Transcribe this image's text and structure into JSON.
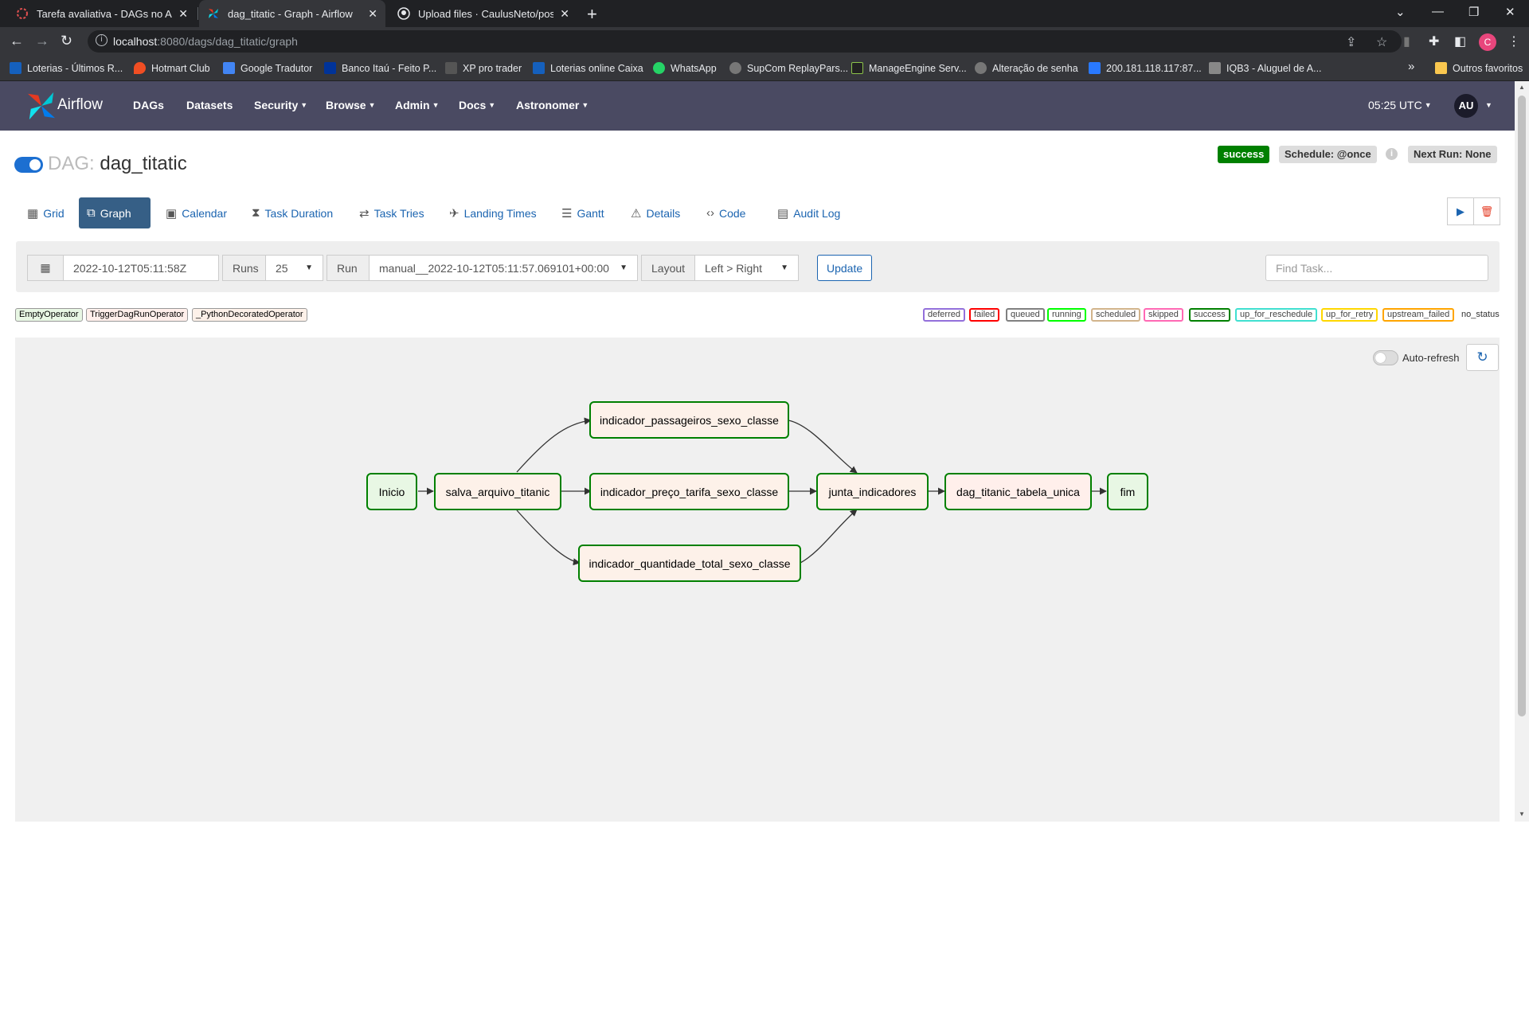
{
  "browser": {
    "tabs": [
      {
        "title": "Tarefa avaliativa - DAGs no Airflo"
      },
      {
        "title": "dag_titatic - Graph - Airflow"
      },
      {
        "title": "Upload files · CaulusNeto/pos-Pr"
      }
    ],
    "url_host": "localhost",
    "url_path": ":8080/dags/dag_titatic/graph",
    "bookmarks": [
      "Loterias - Últimos R...",
      "Hotmart Club",
      "Google Tradutor",
      "Banco Itaú - Feito P...",
      "XP pro trader",
      "Loterias online Caixa",
      "WhatsApp",
      "SupCom ReplayPars...",
      "ManageEngine Serv...",
      "Alteração de senha",
      "200.181.118.117:87...",
      "IQB3 - Aluguel de A..."
    ],
    "bookmarks_more": "»",
    "other_bookmarks": "Outros favoritos",
    "profile_initial": "C"
  },
  "navbar": {
    "brand": "Airflow",
    "links": [
      "DAGs",
      "Datasets",
      "Security",
      "Browse",
      "Admin",
      "Docs",
      "Astronomer"
    ],
    "time": "05:25 UTC",
    "user": "AU"
  },
  "dag": {
    "prefix": "DAG:",
    "name": "dag_titatic",
    "status": "success",
    "schedule": "Schedule: @once",
    "next_run": "Next Run: None"
  },
  "views": [
    "Grid",
    "Graph",
    "Calendar",
    "Task Duration",
    "Task Tries",
    "Landing Times",
    "Gantt",
    "Details",
    "Code",
    "Audit Log"
  ],
  "active_view": "Graph",
  "controls": {
    "date": "2022-10-12T05:11:58Z",
    "runs_label": "Runs",
    "runs_value": "25",
    "run_label": "Run",
    "run_value": "manual__2022-10-12T05:11:57.069101+00:00",
    "layout_label": "Layout",
    "layout_value": "Left > Right",
    "update": "Update",
    "find_placeholder": "Find Task..."
  },
  "operators": [
    "EmptyOperator",
    "TriggerDagRunOperator",
    "_PythonDecoratedOperator"
  ],
  "statuses": [
    {
      "name": "deferred",
      "color": "#9370db"
    },
    {
      "name": "failed",
      "color": "#ff0000"
    },
    {
      "name": "queued",
      "color": "#808080"
    },
    {
      "name": "running",
      "color": "#00ff00"
    },
    {
      "name": "scheduled",
      "color": "#d2b48c"
    },
    {
      "name": "skipped",
      "color": "#ff69b4"
    },
    {
      "name": "success",
      "color": "#008000"
    },
    {
      "name": "up_for_reschedule",
      "color": "#40e0d0"
    },
    {
      "name": "up_for_retry",
      "color": "#ffd700"
    },
    {
      "name": "upstream_failed",
      "color": "#ffa500"
    }
  ],
  "no_status": "no_status",
  "graph": {
    "auto_refresh": "Auto-refresh",
    "tasks": {
      "inicio": "Inicio",
      "salva": "salva_arquivo_titanic",
      "passageiros": "indicador_passageiros_sexo_classe",
      "preco": "indicador_preço_tarifa_sexo_classe",
      "quantidade": "indicador_quantidade_total_sexo_classe",
      "junta": "junta_indicadores",
      "tabela": "dag_titanic_tabela_unica",
      "fim": "fim"
    }
  }
}
